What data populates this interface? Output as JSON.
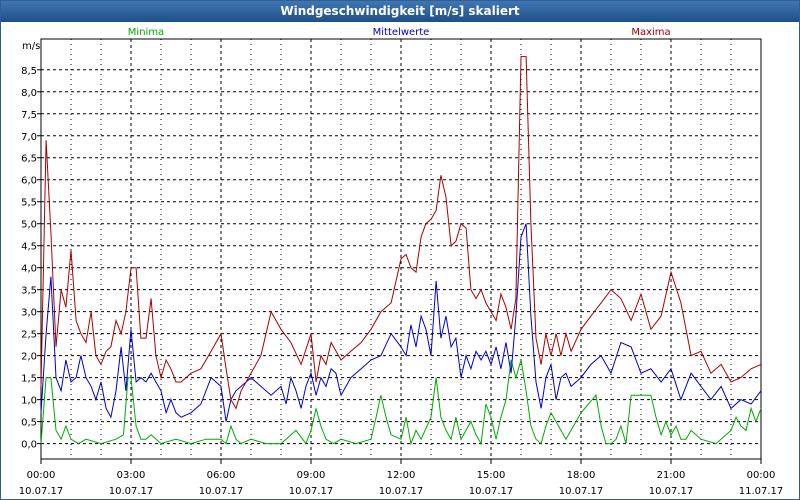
{
  "window": {
    "title": "Windgeschwindigkeit [m/s] skaliert"
  },
  "chart_data": {
    "type": "line",
    "title": "Windgeschwindigkeit [m/s] skaliert",
    "ylabel": "m/s",
    "xlabel": "",
    "ylim": [
      -0.35,
      9.2
    ],
    "xlim": [
      0,
      24
    ],
    "grid": true,
    "legend_position": "top",
    "y_ticks": [
      "0,0",
      "0,5",
      "1,0",
      "1,5",
      "2,0",
      "2,5",
      "3,0",
      "3,5",
      "4,0",
      "4,5",
      "5,0",
      "5,5",
      "6,0",
      "6,5",
      "7,0",
      "7,5",
      "8,0",
      "8,5"
    ],
    "x_ticks": [
      {
        "time": "00:00",
        "date": "10.07.17"
      },
      {
        "time": "03:00",
        "date": "10.07.17"
      },
      {
        "time": "06:00",
        "date": "10.07.17"
      },
      {
        "time": "09:00",
        "date": "10.07.17"
      },
      {
        "time": "12:00",
        "date": "10.07.17"
      },
      {
        "time": "15:00",
        "date": "10.07.17"
      },
      {
        "time": "18:00",
        "date": "10.07.17"
      },
      {
        "time": "21:00",
        "date": "10.07.17"
      },
      {
        "time": "00:00",
        "date": "11.07.17"
      }
    ],
    "series": [
      {
        "name": "Minima",
        "color": "#00aa00",
        "x": [
          0.0,
          0.17,
          0.33,
          0.5,
          0.67,
          0.83,
          1.0,
          1.25,
          1.5,
          2.0,
          2.5,
          2.75,
          2.9,
          3.0,
          3.17,
          3.33,
          3.5,
          3.67,
          4.0,
          4.5,
          5.0,
          5.5,
          6.0,
          6.17,
          6.33,
          6.5,
          6.67,
          7.0,
          7.5,
          8.0,
          8.5,
          8.83,
          9.0,
          9.17,
          9.33,
          9.5,
          9.75,
          10.0,
          10.5,
          11.0,
          11.17,
          11.33,
          11.5,
          11.67,
          12.0,
          12.17,
          12.33,
          12.5,
          12.67,
          13.0,
          13.17,
          13.33,
          13.5,
          13.67,
          13.83,
          14.0,
          14.33,
          14.5,
          14.67,
          14.83,
          15.0,
          15.17,
          15.33,
          15.5,
          15.67,
          15.83,
          16.0,
          16.17,
          16.33,
          16.5,
          16.67,
          16.83,
          17.0,
          17.5,
          18.0,
          18.5,
          18.67,
          18.83,
          19.0,
          19.17,
          19.33,
          19.5,
          19.67,
          19.83,
          20.0,
          20.33,
          20.5,
          20.67,
          20.83,
          21.0,
          21.17,
          21.33,
          21.5,
          21.67,
          22.0,
          22.5,
          23.0,
          23.17,
          23.33,
          23.5,
          23.67,
          23.83,
          24.0
        ],
        "values": [
          0.0,
          1.5,
          1.5,
          0.3,
          0.1,
          0.4,
          0.1,
          0.0,
          0.1,
          0.0,
          0.1,
          0.2,
          1.5,
          1.5,
          0.4,
          0.1,
          0.1,
          0.2,
          0.0,
          0.1,
          0.0,
          0.1,
          0.1,
          0.0,
          0.4,
          0.1,
          0.0,
          0.1,
          0.0,
          0.0,
          0.3,
          0.0,
          0.3,
          0.8,
          0.4,
          0.1,
          0.0,
          0.1,
          0.0,
          0.1,
          0.6,
          1.1,
          0.6,
          0.2,
          0.1,
          0.6,
          0.0,
          0.3,
          0.1,
          0.6,
          1.5,
          0.6,
          0.3,
          0.1,
          0.6,
          0.1,
          0.5,
          0.2,
          0.0,
          0.9,
          0.6,
          0.1,
          0.6,
          1.0,
          1.9,
          1.5,
          1.9,
          1.2,
          0.4,
          0.1,
          0.0,
          0.4,
          0.7,
          0.1,
          0.7,
          1.1,
          0.4,
          0.0,
          0.0,
          0.1,
          0.4,
          0.0,
          1.1,
          1.1,
          1.1,
          1.1,
          0.6,
          0.2,
          0.5,
          0.2,
          0.4,
          0.1,
          0.1,
          0.3,
          0.1,
          0.0,
          0.3,
          0.6,
          0.4,
          0.3,
          0.8,
          0.5,
          0.8
        ]
      },
      {
        "name": "Mittelwerte",
        "color": "#0000cc",
        "x": [
          0.0,
          0.17,
          0.33,
          0.5,
          0.67,
          0.83,
          1.0,
          1.17,
          1.33,
          1.5,
          1.67,
          1.83,
          2.0,
          2.17,
          2.33,
          2.5,
          2.67,
          2.83,
          3.0,
          3.17,
          3.33,
          3.5,
          3.67,
          3.83,
          4.0,
          4.17,
          4.33,
          4.5,
          4.67,
          5.0,
          5.33,
          5.67,
          6.0,
          6.17,
          6.33,
          6.5,
          6.67,
          7.0,
          7.33,
          7.67,
          8.0,
          8.17,
          8.33,
          8.5,
          8.67,
          8.83,
          9.0,
          9.17,
          9.33,
          9.5,
          9.67,
          9.83,
          10.0,
          10.33,
          10.67,
          11.0,
          11.33,
          11.67,
          12.0,
          12.17,
          12.33,
          12.5,
          12.67,
          12.83,
          13.0,
          13.17,
          13.33,
          13.5,
          13.67,
          13.83,
          14.0,
          14.17,
          14.33,
          14.5,
          14.67,
          14.83,
          15.0,
          15.17,
          15.33,
          15.5,
          15.67,
          15.83,
          16.0,
          16.17,
          16.33,
          16.5,
          16.67,
          16.83,
          17.0,
          17.17,
          17.33,
          17.5,
          17.67,
          18.0,
          18.33,
          18.67,
          19.0,
          19.33,
          19.67,
          20.0,
          20.33,
          20.67,
          21.0,
          21.33,
          21.67,
          22.0,
          22.33,
          22.67,
          23.0,
          23.33,
          23.67,
          24.0
        ],
        "values": [
          0.7,
          2.5,
          3.8,
          1.5,
          1.2,
          1.9,
          1.4,
          1.5,
          2.0,
          1.5,
          1.3,
          1.0,
          1.4,
          0.8,
          0.6,
          1.2,
          2.2,
          1.2,
          2.6,
          1.4,
          1.5,
          1.4,
          1.6,
          1.4,
          1.2,
          0.7,
          1.0,
          0.7,
          0.6,
          0.7,
          0.9,
          1.5,
          1.3,
          0.5,
          1.0,
          1.2,
          1.3,
          1.5,
          1.3,
          1.1,
          1.3,
          0.9,
          1.5,
          1.2,
          0.8,
          1.3,
          1.6,
          1.1,
          1.5,
          1.3,
          1.7,
          1.6,
          1.1,
          1.5,
          1.7,
          1.9,
          2.0,
          2.5,
          2.2,
          2.0,
          2.7,
          2.2,
          2.9,
          2.6,
          2.0,
          3.7,
          2.4,
          2.9,
          2.2,
          2.4,
          1.5,
          2.0,
          1.7,
          2.1,
          1.9,
          2.1,
          1.8,
          2.2,
          1.7,
          2.3,
          1.6,
          2.9,
          4.7,
          5.0,
          2.9,
          1.4,
          0.8,
          1.5,
          1.8,
          1.0,
          1.5,
          1.6,
          1.3,
          1.5,
          1.8,
          2.0,
          1.6,
          2.3,
          2.2,
          1.6,
          1.7,
          1.4,
          1.7,
          1.0,
          1.6,
          1.3,
          1.0,
          1.3,
          0.8,
          1.0,
          0.9,
          1.2
        ]
      },
      {
        "name": "Maxima",
        "color": "#aa0000",
        "x": [
          0.0,
          0.17,
          0.33,
          0.5,
          0.67,
          0.83,
          1.0,
          1.17,
          1.33,
          1.5,
          1.67,
          1.83,
          2.0,
          2.17,
          2.33,
          2.5,
          2.67,
          2.83,
          3.0,
          3.17,
          3.33,
          3.5,
          3.67,
          3.83,
          4.0,
          4.17,
          4.33,
          4.5,
          4.67,
          5.0,
          5.33,
          5.67,
          6.0,
          6.17,
          6.33,
          6.5,
          6.67,
          7.0,
          7.33,
          7.67,
          8.0,
          8.33,
          8.67,
          9.0,
          9.17,
          9.33,
          9.5,
          9.67,
          10.0,
          10.33,
          10.67,
          11.0,
          11.33,
          11.67,
          12.0,
          12.17,
          12.33,
          12.5,
          12.67,
          12.83,
          13.0,
          13.17,
          13.33,
          13.5,
          13.67,
          13.83,
          14.0,
          14.17,
          14.33,
          14.5,
          14.67,
          14.83,
          15.0,
          15.17,
          15.33,
          15.5,
          15.67,
          15.83,
          16.0,
          16.17,
          16.33,
          16.5,
          16.67,
          16.83,
          17.0,
          17.17,
          17.33,
          17.5,
          17.67,
          18.0,
          18.33,
          18.67,
          19.0,
          19.33,
          19.67,
          20.0,
          20.33,
          20.67,
          21.0,
          21.33,
          21.67,
          22.0,
          22.33,
          22.67,
          23.0,
          23.33,
          23.67,
          24.0
        ],
        "values": [
          1.3,
          6.9,
          4.8,
          2.2,
          3.5,
          3.1,
          4.4,
          2.8,
          2.5,
          2.3,
          3.0,
          2.0,
          1.8,
          2.1,
          2.2,
          2.8,
          2.5,
          3.0,
          4.0,
          4.0,
          2.4,
          2.4,
          3.3,
          2.0,
          1.5,
          1.9,
          1.7,
          1.4,
          1.4,
          1.6,
          1.7,
          2.1,
          2.5,
          1.7,
          1.0,
          0.8,
          1.2,
          1.6,
          2.0,
          3.0,
          2.6,
          2.3,
          1.8,
          2.5,
          1.4,
          2.0,
          1.8,
          2.3,
          1.9,
          2.1,
          2.3,
          2.6,
          3.0,
          3.2,
          4.2,
          4.3,
          4.0,
          3.9,
          4.7,
          5.0,
          5.1,
          5.3,
          6.1,
          5.6,
          4.5,
          4.6,
          5.0,
          4.9,
          3.5,
          3.3,
          3.5,
          3.2,
          3.0,
          2.8,
          3.4,
          3.1,
          2.6,
          3.3,
          8.8,
          8.8,
          5.0,
          2.4,
          1.8,
          2.5,
          2.0,
          2.5,
          2.0,
          2.5,
          2.1,
          2.6,
          2.9,
          3.2,
          3.5,
          3.3,
          2.8,
          3.4,
          2.6,
          2.9,
          3.9,
          3.2,
          2.0,
          2.1,
          1.6,
          1.8,
          1.4,
          1.5,
          1.7,
          1.8
        ]
      }
    ]
  }
}
